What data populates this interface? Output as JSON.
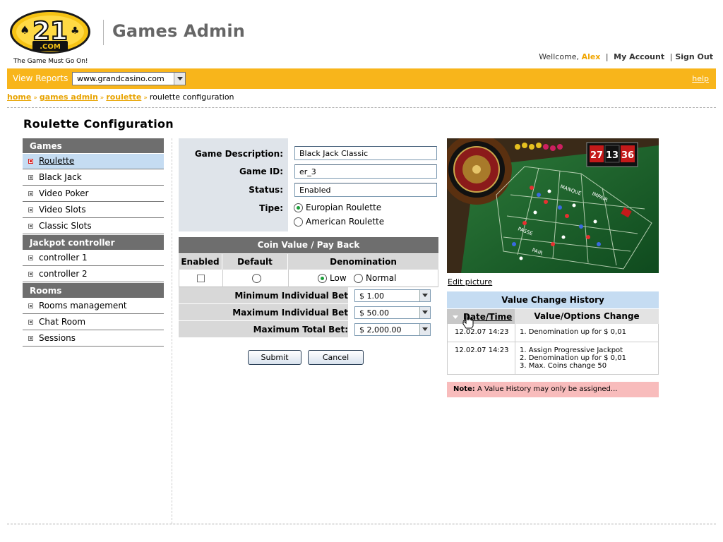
{
  "brand": {
    "logo_number": "21",
    "logo_domain": ".COM",
    "tagline": "The Game Must Go On!",
    "app_title": "Games Admin",
    "colors": {
      "accent_yellow": "#f8b51b",
      "link_orange": "#e8a300",
      "header_gray": "#6e6e6e",
      "active_blue": "#c5dcf2",
      "note_pink": "#f8bcbc"
    }
  },
  "user": {
    "welcome": "Wellcome,",
    "name": "Alex",
    "my_account": "My Account",
    "sign_out": "Sign Out"
  },
  "topbar": {
    "view_reports": "View Reports",
    "site_select_value": "www.grandcasino.com",
    "help": "help"
  },
  "breadcrumb": {
    "home": "home",
    "games_admin": "games admin",
    "roulette": "roulette",
    "current": "roulette configuration",
    "separator": "»"
  },
  "page_title": "Roulette Configuration",
  "sidebar": {
    "games_header": "Games",
    "games": [
      "Roulette",
      "Black Jack",
      "Video Poker",
      "Video Slots",
      "Classic Slots"
    ],
    "jackpot_header": "Jackpot controller",
    "jackpot": [
      "controller 1",
      "controller 2"
    ],
    "rooms_header": "Rooms",
    "rooms": [
      "Rooms management",
      "Chat Room",
      "Sessions"
    ]
  },
  "form": {
    "desc_label": "Game Description:",
    "desc_value": "Black Jack Classic",
    "id_label": "Game ID:",
    "id_value": "er_3",
    "status_label": "Status:",
    "status_value": "Enabled",
    "type_label": "Tipe:",
    "type_opt1": "Europian Roulette",
    "type_opt2": "American Roulette",
    "type_selected": "Europian Roulette"
  },
  "coin": {
    "title": "Coin Value / Pay Back",
    "col_enabled": "Enabled",
    "col_default": "Default",
    "col_denomination": "Denomination",
    "denom_low": "Low",
    "denom_normal": "Normal",
    "denom_selected": "Low",
    "min_label": "Minimum Individual Bet",
    "min_value": "$ 1.00",
    "max_label": "Maximum Individual Bet",
    "max_value": "$ 50.00",
    "max_total_label": "Maximum Total Bet:",
    "max_total_value": "$ 2,000.00"
  },
  "buttons": {
    "submit": "Submit",
    "cancel": "Cancel"
  },
  "picture": {
    "edit_label": "Edit picture",
    "display_numbers": [
      "27",
      "13",
      "36"
    ],
    "table_words": [
      "MANQUE",
      "IMPAIR",
      "PASSE",
      "PAIR"
    ]
  },
  "history": {
    "title": "Value Change History",
    "col_date": "Date/Time",
    "col_value": "Value/Options Change",
    "rows": [
      {
        "date": "12.02.07 14:23",
        "lines": [
          "1. Denomination up for $ 0,01"
        ]
      },
      {
        "date": "12.02.07 14:23",
        "lines": [
          "1. Assign Progressive Jackpot",
          "2. Denomination up for $ 0,01",
          "3. Max. Coins change 50"
        ]
      }
    ]
  },
  "note": {
    "label": "Note:",
    "text": "A Value History may only be assigned..."
  }
}
